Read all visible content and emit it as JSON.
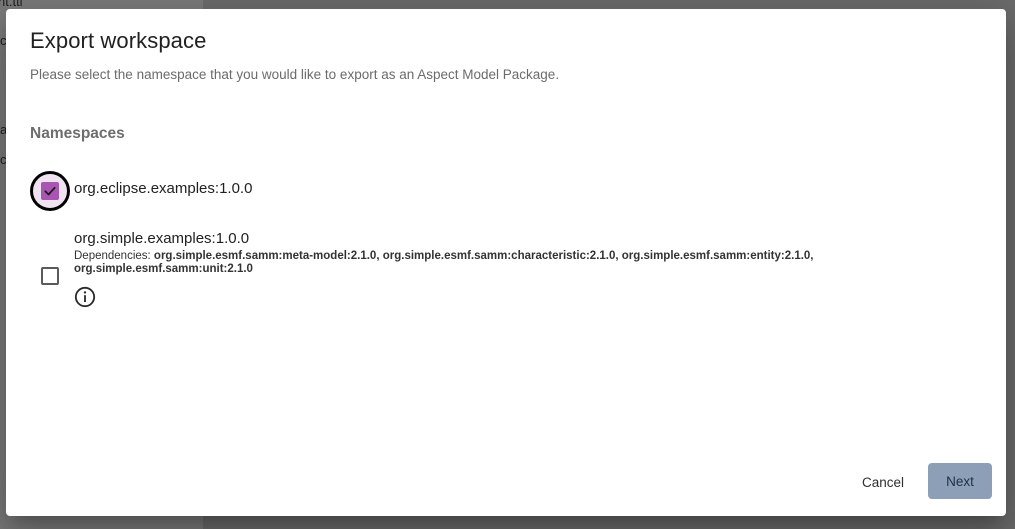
{
  "background": {
    "fragments": [
      "nt.ttl",
      "cl",
      "ar",
      "cl"
    ]
  },
  "dialog": {
    "title": "Export workspace",
    "subtitle": "Please select the namespace that you would like to export as an Aspect Model Package.",
    "section_title": "Namespaces",
    "namespaces": [
      {
        "name": "org.eclipse.examples:1.0.0",
        "checked": true
      },
      {
        "name": "org.simple.examples:1.0.0",
        "checked": false,
        "dependencies_label": "Dependencies: ",
        "dependencies": "org.simple.esmf.samm:meta-model:2.1.0, org.simple.esmf.samm:characteristic:2.1.0, org.simple.esmf.samm:entity:2.1.0, org.simple.esmf.samm:unit:2.1.0",
        "info_icon": "info-icon"
      }
    ],
    "cancel_label": "Cancel",
    "next_label": "Next"
  },
  "colors": {
    "accent": "#a855b3",
    "next_button": "#8c9fb7"
  }
}
